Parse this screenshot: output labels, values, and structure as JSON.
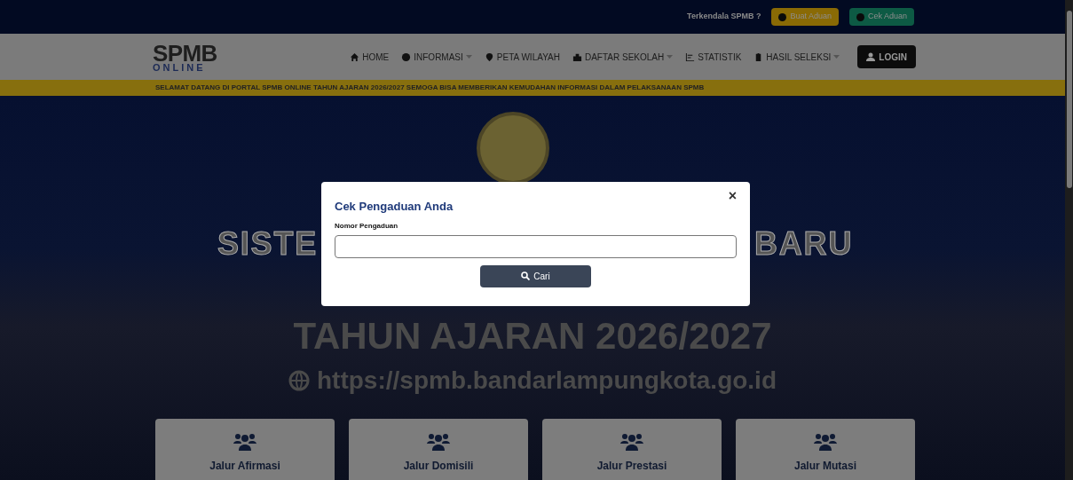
{
  "top_bar": {
    "question": "Terkendala SPMB ?",
    "buttons": [
      {
        "label": "Buat Aduan",
        "kind": "warning"
      },
      {
        "label": "Cek Aduan",
        "kind": "success"
      }
    ]
  },
  "navbar": {
    "logo": {
      "title": "SPMB",
      "subtitle": "ONLINE"
    },
    "items": [
      {
        "label": "HOME",
        "dropdown": false
      },
      {
        "label": "INFORMASI",
        "dropdown": true
      },
      {
        "label": "PETA WILAYAH",
        "dropdown": false
      },
      {
        "label": "DAFTAR SEKOLAH",
        "dropdown": true
      },
      {
        "label": "STATISTIK",
        "dropdown": false
      },
      {
        "label": "HASIL SELEKSI",
        "dropdown": true
      }
    ],
    "login": "LOGIN"
  },
  "ticker": "SELAMAT DATANG DI PORTAL SPMB ONLINE TAHUN AJARAN 2026/2027 SEMOGA BISA MEMBERIKAN KEMUDAHAN INFORMASI DALAM PELAKSANAAN SPMB",
  "hero": {
    "title_left": "SISTE",
    "title_right": "BARU",
    "year": "TAHUN AJARAN 2026/2027",
    "url": "https://spmb.bandarlampungkota.go.id"
  },
  "cards": [
    {
      "label": "Jalur Afirmasi"
    },
    {
      "label": "Jalur Domisili"
    },
    {
      "label": "Jalur Prestasi"
    },
    {
      "label": "Jalur Mutasi"
    }
  ],
  "modal": {
    "title": "Cek Pengaduan Anda",
    "close": "×",
    "field_label": "Nomor Pengaduan",
    "button": "Cari"
  }
}
